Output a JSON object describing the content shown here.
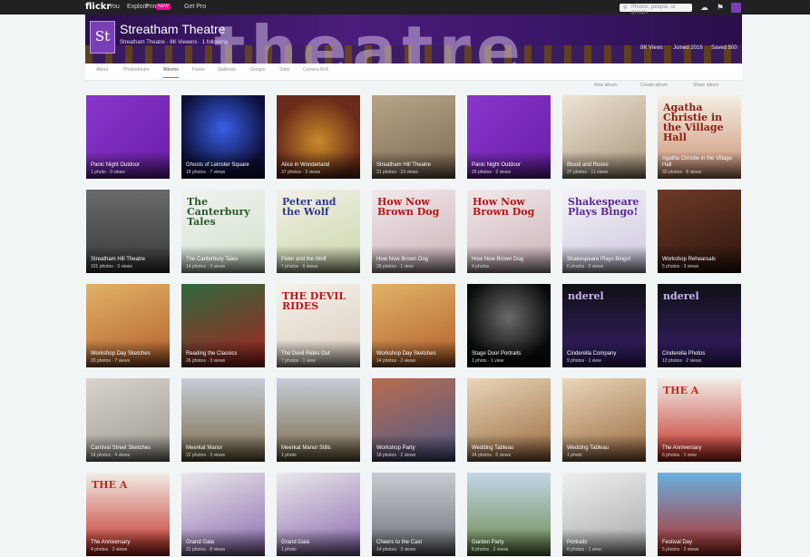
{
  "topnav": {
    "logo": "flickr",
    "links": [
      "You",
      "Explore",
      "Prints",
      "Get Pro"
    ],
    "new_badge": "NEW",
    "search_placeholder": "Photos, people, or groups"
  },
  "group": {
    "name": "Streatham Theatre",
    "banner_word": "theatre",
    "logo_text": "St",
    "subtitle": "Streatham Theatre · 8K Viewers · 1 following",
    "stats": [
      "8K Views",
      "Joined 2016",
      "Saved 500"
    ]
  },
  "subnav": {
    "tabs": [
      "About",
      "Photostream",
      "Albums",
      "Faves",
      "Galleries",
      "Groups",
      "Stats",
      "Camera Roll"
    ],
    "active": "Albums"
  },
  "actions": [
    "New album",
    "Create album",
    "Share album"
  ],
  "colors": {
    "accent": "#3a8fd0",
    "brand_purple": "#7a3fb6",
    "topnav_bg": "#212124"
  },
  "albums": [
    {
      "title": "Panic Night Outdoor",
      "meta": "1 photo · 0 views",
      "bg": "linear-gradient(135deg,#8a35cc,#6a1fa8)"
    },
    {
      "title": "Ghosts of Leinster Square",
      "meta": "18 photos · 7 views",
      "bg": "radial-gradient(circle at 50% 40%,#3a60e8,#0d0f3a 70%)"
    },
    {
      "title": "Alice in Wonderland",
      "meta": "37 photos · 2 views",
      "bg": "radial-gradient(circle at 50% 55%,#c98a2a,#6a2b1a 70%)"
    },
    {
      "title": "Streatham Hill Theatre",
      "meta": "31 photos · 19 views",
      "bg": "linear-gradient(160deg,#b8a488,#7d6a52)"
    },
    {
      "title": "Panic Night Outdoor",
      "meta": "29 photos · 2 views",
      "bg": "linear-gradient(135deg,#8a35cc,#6a1fa8)"
    },
    {
      "title": "Blood and Roses",
      "meta": "27 photos · 11 views",
      "bg": "linear-gradient(150deg,#ede4d4,#a9967a)"
    },
    {
      "title": "Agatha Christie in the Village Hall",
      "meta": "32 photos · 8 views",
      "bg": "linear-gradient(180deg,#f4efe4,#c98e6f)",
      "overlay": "Agatha Christie in the Village Hall",
      "overlay_color": "#8c1e12"
    },
    {
      "title": "Streatham Hill Theatre",
      "meta": "101 photos · 3 views",
      "bg": "linear-gradient(180deg,#6a6a6a,#3a3a3a)"
    },
    {
      "title": "The Canterbury Tales",
      "meta": "14 photos · 3 views",
      "bg": "linear-gradient(160deg,#f2f2f2,#cfe1c9)",
      "overlay": "The Canterbury Tales",
      "overlay_color": "#2a5a2a"
    },
    {
      "title": "Peter and the Wolf",
      "meta": "7 photos · 6 views",
      "bg": "linear-gradient(160deg,#f3f0e8,#c9d6a6)",
      "overlay": "Peter and the Wolf",
      "overlay_color": "#2d3b8a"
    },
    {
      "title": "How Now Brown Dog",
      "meta": "28 photos · 1 view",
      "bg": "linear-gradient(160deg,#f2e8ea,#c9b2b6)",
      "overlay": "How Now Brown Dog",
      "overlay_color": "#b01818"
    },
    {
      "title": "How Now Brown Dog",
      "meta": "4 photos",
      "bg": "linear-gradient(160deg,#f2e8ea,#c9b2b6)",
      "overlay": "How Now Brown Dog",
      "overlay_color": "#b01818"
    },
    {
      "title": "Shakespeare Plays Bingo!",
      "meta": "6 photos · 2 views",
      "bg": "linear-gradient(160deg,#f4f2f8,#cec6de)",
      "overlay": "Shakespeare Plays Bingo!",
      "overlay_color": "#5b2a8e"
    },
    {
      "title": "Workshop Rehearsals",
      "meta": "5 photos · 3 views",
      "bg": "linear-gradient(160deg,#6e3a26,#2c150e)"
    },
    {
      "title": "Workshop Day Sketches",
      "meta": "20 photos · 7 views",
      "bg": "linear-gradient(160deg,#e0b268,#b4602c)"
    },
    {
      "title": "Reading the Classics",
      "meta": "26 photos · 3 views",
      "bg": "linear-gradient(160deg,#2e6a3e,#a8231f)"
    },
    {
      "title": "The Devil Rides Out",
      "meta": "7 photos · 1 view",
      "bg": "linear-gradient(160deg,#f6f1ea,#d8cdbd)",
      "overlay": "THE DEVIL RIDES",
      "overlay_color": "#b81818"
    },
    {
      "title": "Workshop Day Sketches",
      "meta": "14 photos · 2 views",
      "bg": "linear-gradient(160deg,#e0b268,#b4602c)"
    },
    {
      "title": "Stage Door Portraits",
      "meta": "1 photo · 1 view",
      "bg": "radial-gradient(circle at 50% 40%,#6a6a6a,#0a0a0a 70%)"
    },
    {
      "title": "Cinderella Company",
      "meta": "9 photos · 1 view",
      "bg": "linear-gradient(180deg,#101014,#3a2070)",
      "overlay": "nderel",
      "overlay_color": "#c9b3f0"
    },
    {
      "title": "Cinderella Photos",
      "meta": "12 photos · 2 views",
      "bg": "linear-gradient(180deg,#101014,#3a2070)",
      "overlay": "nderel",
      "overlay_color": "#c9b3f0"
    },
    {
      "title": "Carnival Street Sketches",
      "meta": "16 photos · 4 views",
      "bg": "linear-gradient(160deg,#d8d4cc,#9e9890)"
    },
    {
      "title": "Meerkat Manor",
      "meta": "22 photos · 3 views",
      "bg": "linear-gradient(180deg,#c6cdd7,#7a6a4a)"
    },
    {
      "title": "Meerkat Manor Stills",
      "meta": "1 photo",
      "bg": "linear-gradient(180deg,#c6cdd7,#7a6a4a)"
    },
    {
      "title": "Workshop Party",
      "meta": "18 photos · 2 views",
      "bg": "linear-gradient(160deg,#b86c4e,#4e5a8a)"
    },
    {
      "title": "Wedding Tableau",
      "meta": "24 photos · 5 views",
      "bg": "linear-gradient(160deg,#e9d6b8,#9a6a40)"
    },
    {
      "title": "Wedding Tableau",
      "meta": "1 photo",
      "bg": "linear-gradient(160deg,#e9d6b8,#9a6a40)"
    },
    {
      "title": "The Anniversary",
      "meta": "6 photos · 1 view",
      "bg": "linear-gradient(180deg,#f1ede6,#c22a20)",
      "overlay": "THE A",
      "overlay_color": "#c22a20"
    },
    {
      "title": "The Anniversary",
      "meta": "4 photos · 2 views",
      "bg": "linear-gradient(180deg,#f1ede6,#c22a20)",
      "overlay": "THE A",
      "overlay_color": "#c22a20"
    },
    {
      "title": "Grand Gala",
      "meta": "31 photos · 8 views",
      "bg": "linear-gradient(160deg,#eae8ea,#8a6ab0)"
    },
    {
      "title": "Grand Gala",
      "meta": "1 photo",
      "bg": "linear-gradient(160deg,#eae8ea,#8a6ab0)"
    },
    {
      "title": "Cheers to the Cast",
      "meta": "14 photos · 3 views",
      "bg": "linear-gradient(180deg,#c8ccd2,#6a6f78)"
    },
    {
      "title": "Garden Party",
      "meta": "8 photos · 2 views",
      "bg": "linear-gradient(180deg,#c3d6e8,#6b8a4a)"
    },
    {
      "title": "Portraits",
      "meta": "8 photos · 1 view",
      "bg": "linear-gradient(160deg,#efefef,#a8a8a8)"
    },
    {
      "title": "Festival Day",
      "meta": "5 photos · 2 views",
      "bg": "linear-gradient(180deg,#6ab0e0,#b22d24)"
    }
  ]
}
